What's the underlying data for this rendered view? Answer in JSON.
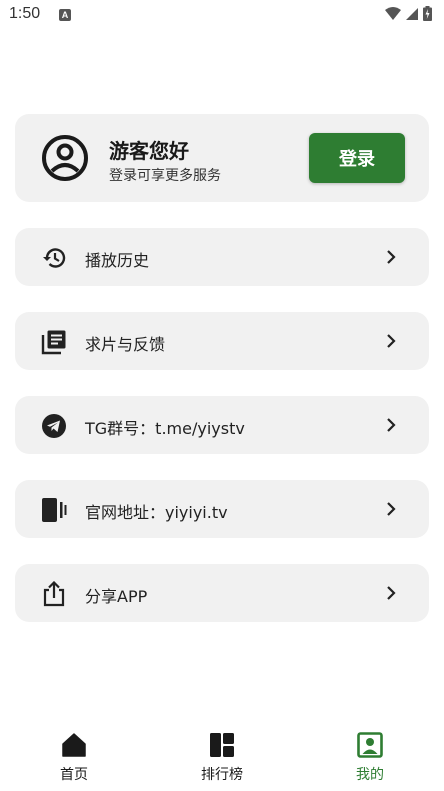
{
  "status_bar": {
    "time": "1:50",
    "badge": "A"
  },
  "profile": {
    "greeting": "游客您好",
    "subtitle": "登录可享更多服务",
    "login_label": "登录"
  },
  "menu": [
    {
      "label": "播放历史",
      "icon": "history-icon"
    },
    {
      "label": "求片与反馈",
      "icon": "library-books-icon"
    },
    {
      "label": "TG群号：t.me/yiystv",
      "icon": "telegram-icon"
    },
    {
      "label": "官网地址：yiyiyi.tv",
      "icon": "phone-device-icon"
    },
    {
      "label": "分享APP",
      "icon": "share-icon"
    }
  ],
  "bottom_nav": {
    "items": [
      {
        "label": "首页",
        "icon": "home-icon"
      },
      {
        "label": "排行榜",
        "icon": "leaderboard-icon"
      },
      {
        "label": "我的",
        "icon": "account-box-icon",
        "active": true
      }
    ]
  },
  "colors": {
    "accent": "#2e7d32",
    "card_bg": "#f1f1f1"
  }
}
